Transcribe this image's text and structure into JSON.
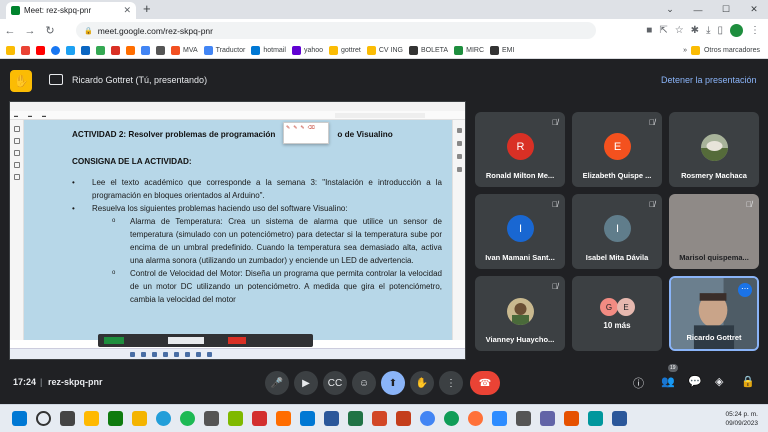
{
  "browser": {
    "tab_title": "Meet: rez-skpq-pnr",
    "url": "meet.google.com/rez-skpq-pnr",
    "bookmarks": [
      "MVA",
      "Traductor",
      "hotmail",
      "yahoo",
      "gottret",
      "CV ING",
      "BOLETA",
      "MIRC",
      "EMI"
    ],
    "other_bookmarks": "Otros marcadores"
  },
  "meet": {
    "presenter_label": "Ricardo Gottret (Tú, presentando)",
    "stop_presenting": "Detener la presentación",
    "time": "17:24",
    "meeting_code": "rez-skpq-pnr",
    "people_badge": "19"
  },
  "document": {
    "title": "ACTIVIDAD 2: Resolver problemas de programación",
    "title_tail": "o de Visualino",
    "section": "CONSIGNA DE LA ACTIVIDAD:",
    "bullet1": "Lee el texto académico que corresponde a la semana 3: \"Instalación e introducción a la programación en bloques orientados al Arduino\".",
    "bullet2": "Resuelva los siguientes problemas haciendo uso del software Visualino:",
    "sub1": "Alarma de Temperatura: Crea un sistema de alarma que utilice un sensor de temperatura (simulado con un potenciómetro) para detectar si la temperatura sube por encima de un umbral predefinido. Cuando la temperatura sea demasiado alta, activa una alarma sonora (utilizando un zumbador) y enciende un LED de advertencia.",
    "sub2": "Control de Velocidad del Motor: Diseña un programa que permita controlar la velocidad de un motor DC utilizando un potenciómetro. A medida que gira el potenciómetro, cambia la velocidad del motor"
  },
  "participants": [
    {
      "name": "Ronald Milton Me...",
      "initial": "R",
      "color": "#d93025"
    },
    {
      "name": "Elizabeth Quispe ...",
      "initial": "E",
      "color": "#f4511e"
    },
    {
      "name": "Rosmery Machaca",
      "initial": "",
      "color": "#6b7a55"
    },
    {
      "name": "Ivan Mamani Sant...",
      "initial": "I",
      "color": "#1967d2"
    },
    {
      "name": "Isabel Mita Dávila",
      "initial": "I",
      "color": "#607d8b"
    },
    {
      "name": "Marisol quispema...",
      "initial": "",
      "color": "#8f8a87"
    },
    {
      "name": "Vianney Huaycho...",
      "initial": "",
      "color": "#7a6a4a"
    },
    {
      "name": "10 más",
      "initial": "",
      "color": "#3c4043"
    },
    {
      "name": "Ricardo Gottret",
      "initial": "",
      "color": "#5f6c77"
    }
  ],
  "more": {
    "a": "G",
    "b": "E",
    "a_color": "#f28b82",
    "b_color": "#e6b8af"
  },
  "taskbar": {
    "time": "05:24 p. m.",
    "date": "09/09/2023"
  },
  "icons": {
    "mic": "microphone-icon",
    "cam": "camera-icon",
    "cc": "captions-icon",
    "emoji": "emoji-icon",
    "present": "present-icon",
    "hand": "raise-hand-icon",
    "more": "more-icon",
    "end": "end-call-icon"
  }
}
